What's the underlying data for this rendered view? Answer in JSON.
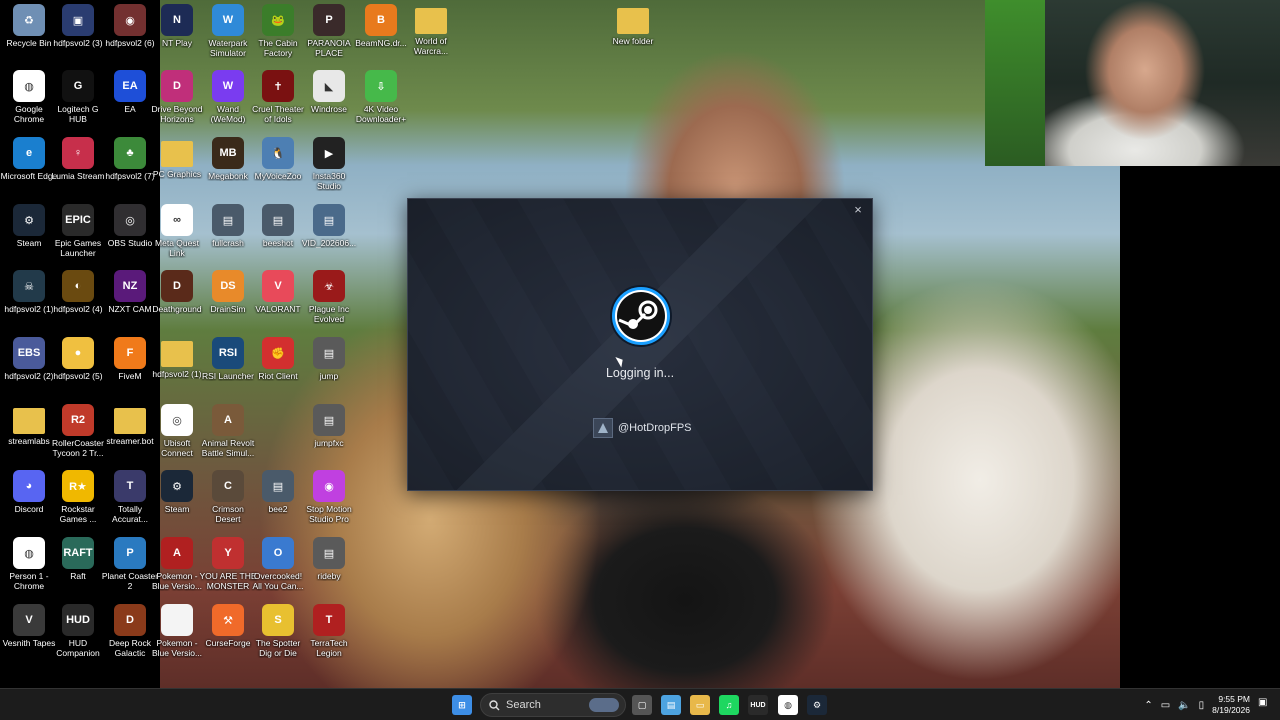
{
  "desktop": {
    "icons": [
      {
        "label": "Recycle Bin",
        "icon": "recycle-bin-icon",
        "color": "#6f8fb4",
        "glyph": "♻"
      },
      {
        "label": "hdfpsvol2 (3)",
        "icon": "hdfpsvol2-icon",
        "color": "#2a3c70",
        "glyph": "▣"
      },
      {
        "label": "hdfpsvol2 (6)",
        "icon": "hdfpsvol2-icon",
        "color": "#733030",
        "glyph": "◉"
      },
      {
        "label": "NT Play",
        "icon": "nt-play-icon",
        "color": "#1d2b55",
        "glyph": "N"
      },
      {
        "label": "Waterpark Simulator",
        "icon": "waterpark-icon",
        "color": "#2f8ad8",
        "glyph": "W"
      },
      {
        "label": "The Cabin Factory",
        "icon": "cabin-factory-icon",
        "color": "#3b7d2a",
        "glyph": "🐸"
      },
      {
        "label": "PARANOIA PLACE",
        "icon": "paranoia-icon",
        "color": "#3a2a2a",
        "glyph": "P"
      },
      {
        "label": "BeamNG.dr...",
        "icon": "beamng-icon",
        "color": "#e87a1d",
        "glyph": "B"
      },
      {
        "label": "World of Warcra...",
        "icon": "folder-icon",
        "color": "#e8c14c",
        "glyph": ""
      },
      {
        "label": "New folder",
        "icon": "folder-icon",
        "color": "#e8c14c",
        "glyph": ""
      },
      {
        "label": "Google Chrome",
        "icon": "chrome-icon",
        "color": "#ffffff",
        "glyph": "◍"
      },
      {
        "label": "Logitech G HUB",
        "icon": "logitech-icon",
        "color": "#111111",
        "glyph": "G"
      },
      {
        "label": "EA",
        "icon": "ea-icon",
        "color": "#1e4fd8",
        "glyph": "EA"
      },
      {
        "label": "Drive Beyond Horizons",
        "icon": "drive-beyond-icon",
        "color": "#c02f7a",
        "glyph": "D"
      },
      {
        "label": "Wand (WeMod)",
        "icon": "wand-icon",
        "color": "#7a3cf0",
        "glyph": "W"
      },
      {
        "label": "Cruel Theater of Idols",
        "icon": "cruel-theater-icon",
        "color": "#7a1111",
        "glyph": "✝"
      },
      {
        "label": "Windrose",
        "icon": "windrose-icon",
        "color": "#e8e8e8",
        "glyph": "◣"
      },
      {
        "label": "4K Video Downloader+",
        "icon": "video-downloader-icon",
        "color": "#46b94a",
        "glyph": "⇩"
      },
      {
        "label": "Microsoft Edge",
        "icon": "edge-icon",
        "color": "#1a7fcf",
        "glyph": "e"
      },
      {
        "label": "Lumia Stream",
        "icon": "lumia-icon",
        "color": "#c72f4b",
        "glyph": "♀"
      },
      {
        "label": "hdfpsvol2 (7)",
        "icon": "hdfpsvol2-icon",
        "color": "#3c8a3a",
        "glyph": "♣"
      },
      {
        "label": "PC Graphics",
        "icon": "folder-icon",
        "color": "#e8c14c",
        "glyph": ""
      },
      {
        "label": "Megabonk",
        "icon": "megabonk-icon",
        "color": "#3a2a1a",
        "glyph": "MB"
      },
      {
        "label": "MyVoiceZoo",
        "icon": "myvoicezoo-icon",
        "color": "#4d7fb3",
        "glyph": "🐧"
      },
      {
        "label": "Insta360 Studio",
        "icon": "insta360-icon",
        "color": "#222222",
        "glyph": "▶"
      },
      {
        "label": "Steam",
        "icon": "steam-icon",
        "color": "#1b2838",
        "glyph": "⚙"
      },
      {
        "label": "Epic Games Launcher",
        "icon": "epic-games-icon",
        "color": "#2a2a2a",
        "glyph": "EPIC"
      },
      {
        "label": "OBS Studio",
        "icon": "obs-icon",
        "color": "#302e31",
        "glyph": "◎"
      },
      {
        "label": "Meta Quest Link",
        "icon": "meta-quest-icon",
        "color": "#ffffff",
        "glyph": "∞"
      },
      {
        "label": "fullcrash",
        "icon": "video-file-icon",
        "color": "#4a5a6a",
        "glyph": "▤"
      },
      {
        "label": "beeshot",
        "icon": "video-file-icon",
        "color": "#4a5a6a",
        "glyph": "▤"
      },
      {
        "label": "VID_202606...",
        "icon": "video-file-icon",
        "color": "#4a6a8a",
        "glyph": "▤"
      },
      {
        "label": "hdfpsvol2 (1)",
        "icon": "hdfpsvol2-icon",
        "color": "#223a4a",
        "glyph": "☠"
      },
      {
        "label": "hdfpsvol2 (4)",
        "icon": "hdfpsvol2-icon",
        "color": "#6a4a10",
        "glyph": "◐"
      },
      {
        "label": "NZXT CAM",
        "icon": "nzxt-icon",
        "color": "#5a1a7a",
        "glyph": "NZ"
      },
      {
        "label": "Deathground",
        "icon": "deathground-icon",
        "color": "#5a2a1a",
        "glyph": "D"
      },
      {
        "label": "DrainSim",
        "icon": "drainsim-icon",
        "color": "#e88a2a",
        "glyph": "DS"
      },
      {
        "label": "VALORANT",
        "icon": "valorant-icon",
        "color": "#e84a5a",
        "glyph": "V"
      },
      {
        "label": "Plague Inc Evolved",
        "icon": "plague-icon",
        "color": "#9a1a1a",
        "glyph": "☣"
      },
      {
        "label": "hdfpsvol2 (2)",
        "icon": "hdfpsvol2-icon",
        "color": "#4a5a9a",
        "glyph": "EBS"
      },
      {
        "label": "hdfpsvol2 (5)",
        "icon": "hdfpsvol2-icon",
        "color": "#f0c040",
        "glyph": "●"
      },
      {
        "label": "FiveM",
        "icon": "fivem-icon",
        "color": "#f07a1a",
        "glyph": "F"
      },
      {
        "label": "hdfpsvol2 (1)",
        "icon": "folder-icon",
        "color": "#e8c14c",
        "glyph": ""
      },
      {
        "label": "RSI Launcher",
        "icon": "rsi-icon",
        "color": "#1a4a7a",
        "glyph": "RSI"
      },
      {
        "label": "Riot Client",
        "icon": "riot-icon",
        "color": "#d32f2f",
        "glyph": "✊"
      },
      {
        "label": "jump",
        "icon": "video-file-icon",
        "color": "#5a5a5a",
        "glyph": "▤"
      },
      {
        "label": "streamlabs",
        "icon": "folder-icon",
        "color": "#e8c14c",
        "glyph": ""
      },
      {
        "label": "RollerCoaster Tycoon 2 Tr...",
        "icon": "rollercoaster-icon",
        "color": "#c03a2a",
        "glyph": "R2"
      },
      {
        "label": "streamer.bot",
        "icon": "folder-icon",
        "color": "#e8c14c",
        "glyph": ""
      },
      {
        "label": "Ubisoft Connect",
        "icon": "ubisoft-icon",
        "color": "#ffffff",
        "glyph": "◎"
      },
      {
        "label": "Animal Revolt Battle Simul...",
        "icon": "animal-revolt-icon",
        "color": "#7a5a3a",
        "glyph": "A"
      },
      {
        "label": "jumpfxc",
        "icon": "video-file-icon",
        "color": "#5a5a5a",
        "glyph": "▤"
      },
      {
        "label": "Discord",
        "icon": "discord-icon",
        "color": "#5865f2",
        "glyph": "◕"
      },
      {
        "label": "Rockstar Games ...",
        "icon": "rockstar-icon",
        "color": "#f0b800",
        "glyph": "R★"
      },
      {
        "label": "Totally Accurat...",
        "icon": "tabs-icon",
        "color": "#3a3a6a",
        "glyph": "T"
      },
      {
        "label": "Steam",
        "icon": "steam-icon",
        "color": "#1b2838",
        "glyph": "⚙"
      },
      {
        "label": "Crimson Desert",
        "icon": "crimson-desert-icon",
        "color": "#5a4a3a",
        "glyph": "C"
      },
      {
        "label": "bee2",
        "icon": "video-file-icon",
        "color": "#4a5a6a",
        "glyph": "▤"
      },
      {
        "label": "Stop Motion Studio Pro",
        "icon": "stop-motion-icon",
        "color": "#c040e0",
        "glyph": "◉"
      },
      {
        "label": "Person 1 - Chrome",
        "icon": "chrome-icon",
        "color": "#ffffff",
        "glyph": "◍"
      },
      {
        "label": "Raft",
        "icon": "raft-icon",
        "color": "#2a6a5a",
        "glyph": "RAFT"
      },
      {
        "label": "Planet Coaster 2",
        "icon": "planet-coaster-icon",
        "color": "#2a7ac0",
        "glyph": "P"
      },
      {
        "label": "Pokemon - Blue Versio...",
        "icon": "apex-icon",
        "color": "#b02020",
        "glyph": "A"
      },
      {
        "label": "YOU ARE THE MONSTER",
        "icon": "monster-icon",
        "color": "#c03030",
        "glyph": "Y"
      },
      {
        "label": "Overcooked! All You Can...",
        "icon": "overcooked-icon",
        "color": "#3a7ad0",
        "glyph": "O"
      },
      {
        "label": "rideby",
        "icon": "video-file-icon",
        "color": "#5a5a5a",
        "glyph": "▤"
      },
      {
        "label": "Vesnith Tapes",
        "icon": "vesnith-icon",
        "color": "#3a3a3a",
        "glyph": "V"
      },
      {
        "label": "HUD Companion",
        "icon": "hud-icon",
        "color": "#2a2a2a",
        "glyph": "HUD"
      },
      {
        "label": "Deep Rock Galactic",
        "icon": "deep-rock-icon",
        "color": "#8a3a1a",
        "glyph": "D"
      },
      {
        "label": "Pokemon - Blue Versio...",
        "icon": "file-icon",
        "color": "#f4f4f4",
        "glyph": ""
      },
      {
        "label": "CurseForge",
        "icon": "curseforge-icon",
        "color": "#f06a2a",
        "glyph": "⚒"
      },
      {
        "label": "The Spotter Dig or Die",
        "icon": "spotter-icon",
        "color": "#e8c030",
        "glyph": "S"
      },
      {
        "label": "TerraTech Legion",
        "icon": "terratech-icon",
        "color": "#b02020",
        "glyph": "T"
      }
    ]
  },
  "steam_dialog": {
    "status": "Logging in...",
    "username": "@HotDropFPS",
    "close_glyph": "×",
    "accent": "#1a9fff"
  },
  "taskbar": {
    "search_label": "Search",
    "apps": [
      {
        "icon": "windows-start-icon",
        "color": "#3d8ee6",
        "glyph": "⊞"
      },
      {
        "icon": "task-view-icon",
        "color": "#555555",
        "glyph": "▢"
      },
      {
        "icon": "notepad-icon",
        "color": "#4da3e0",
        "glyph": "▤"
      },
      {
        "icon": "file-explorer-icon",
        "color": "#e8b84a",
        "glyph": "▭"
      },
      {
        "icon": "spotify-icon",
        "color": "#1ed760",
        "glyph": "♫"
      },
      {
        "icon": "hud-icon",
        "color": "#2a2a2a",
        "glyph": "HUD"
      },
      {
        "icon": "chrome-icon",
        "color": "#ffffff",
        "glyph": "◍"
      },
      {
        "icon": "steam-icon",
        "color": "#1b2838",
        "glyph": "⚙"
      }
    ],
    "time": "9:55 PM",
    "date": "8/19/2026"
  }
}
